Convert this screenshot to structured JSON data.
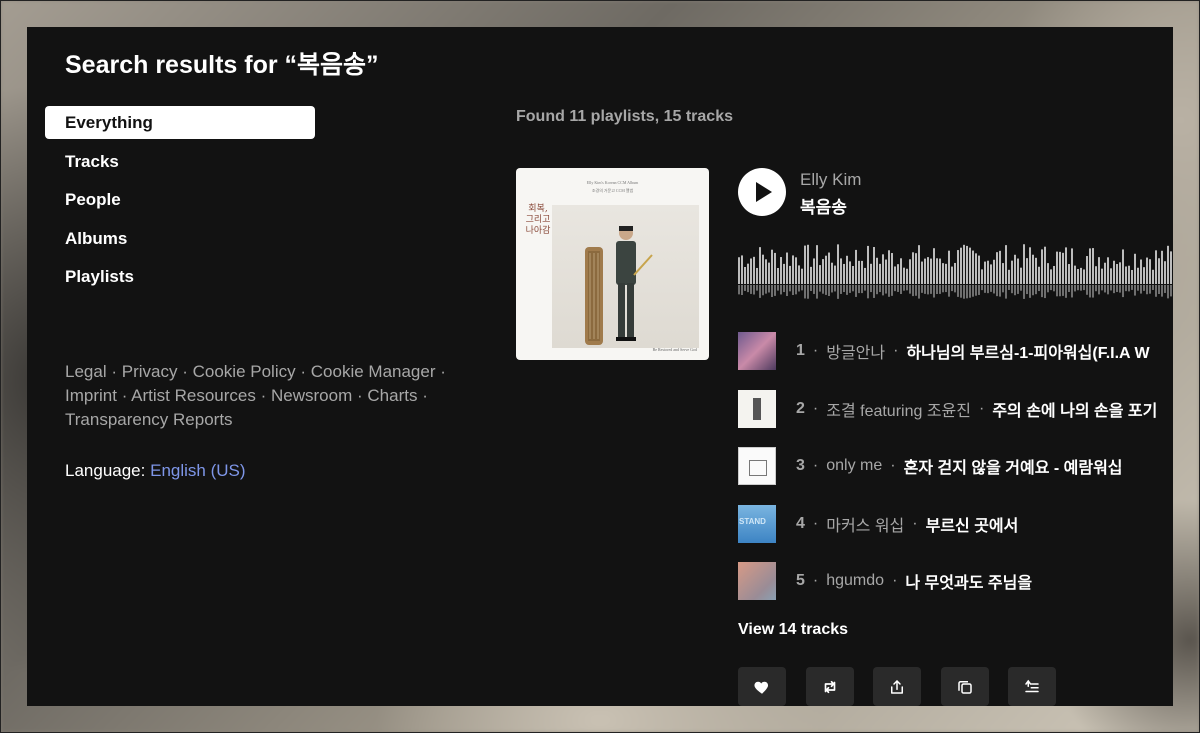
{
  "header": {
    "title": "Search results for “복음송”"
  },
  "nav": {
    "items": [
      {
        "label": "Everything",
        "active": true
      },
      {
        "label": "Tracks"
      },
      {
        "label": "People"
      },
      {
        "label": "Albums"
      },
      {
        "label": "Playlists"
      }
    ]
  },
  "footer": {
    "links": [
      "Legal",
      "Privacy",
      "Cookie Policy",
      "Cookie Manager",
      "Imprint",
      "Artist Resources",
      "Newsroom",
      "Charts",
      "Transparency Reports"
    ],
    "separator": "·",
    "language_label": "Language:",
    "language_value": "English (US)"
  },
  "results": {
    "summary": "Found 11 playlists, 15 tracks",
    "playlist": {
      "artist": "Elly Kim",
      "title": "복음송",
      "cover": {
        "top_line": "Elly Kim's Korean CCM Album",
        "second_line": "조경의 거문고 CCM 앨범",
        "vertical_text": "회복, 그리고 나아감",
        "corner_text": "Be Restored and Serve God"
      },
      "tracks": [
        {
          "num": "1",
          "artist": "방글안나",
          "title": "하나님의 부르심-1-피아워십(F.I.A W"
        },
        {
          "num": "2",
          "artist": "조결 featuring 조윤진",
          "title": "주의 손에 나의 손을 포기"
        },
        {
          "num": "3",
          "artist": "only me",
          "title": "혼자 걷지 않을 거예요 - 예람워십"
        },
        {
          "num": "4",
          "artist": "마커스 워십",
          "title": "부르신 곳에서"
        },
        {
          "num": "5",
          "artist": "hgumdo",
          "title": "나 무엇과도 주님을"
        }
      ],
      "view_all": "View 14 tracks",
      "actions": [
        "heart-icon",
        "repost-icon",
        "share-icon",
        "copy-link-icon",
        "add-to-queue-icon"
      ]
    }
  },
  "colors": {
    "background": "#121212",
    "muted": "#a7a7a7",
    "link": "#7e96e8"
  }
}
